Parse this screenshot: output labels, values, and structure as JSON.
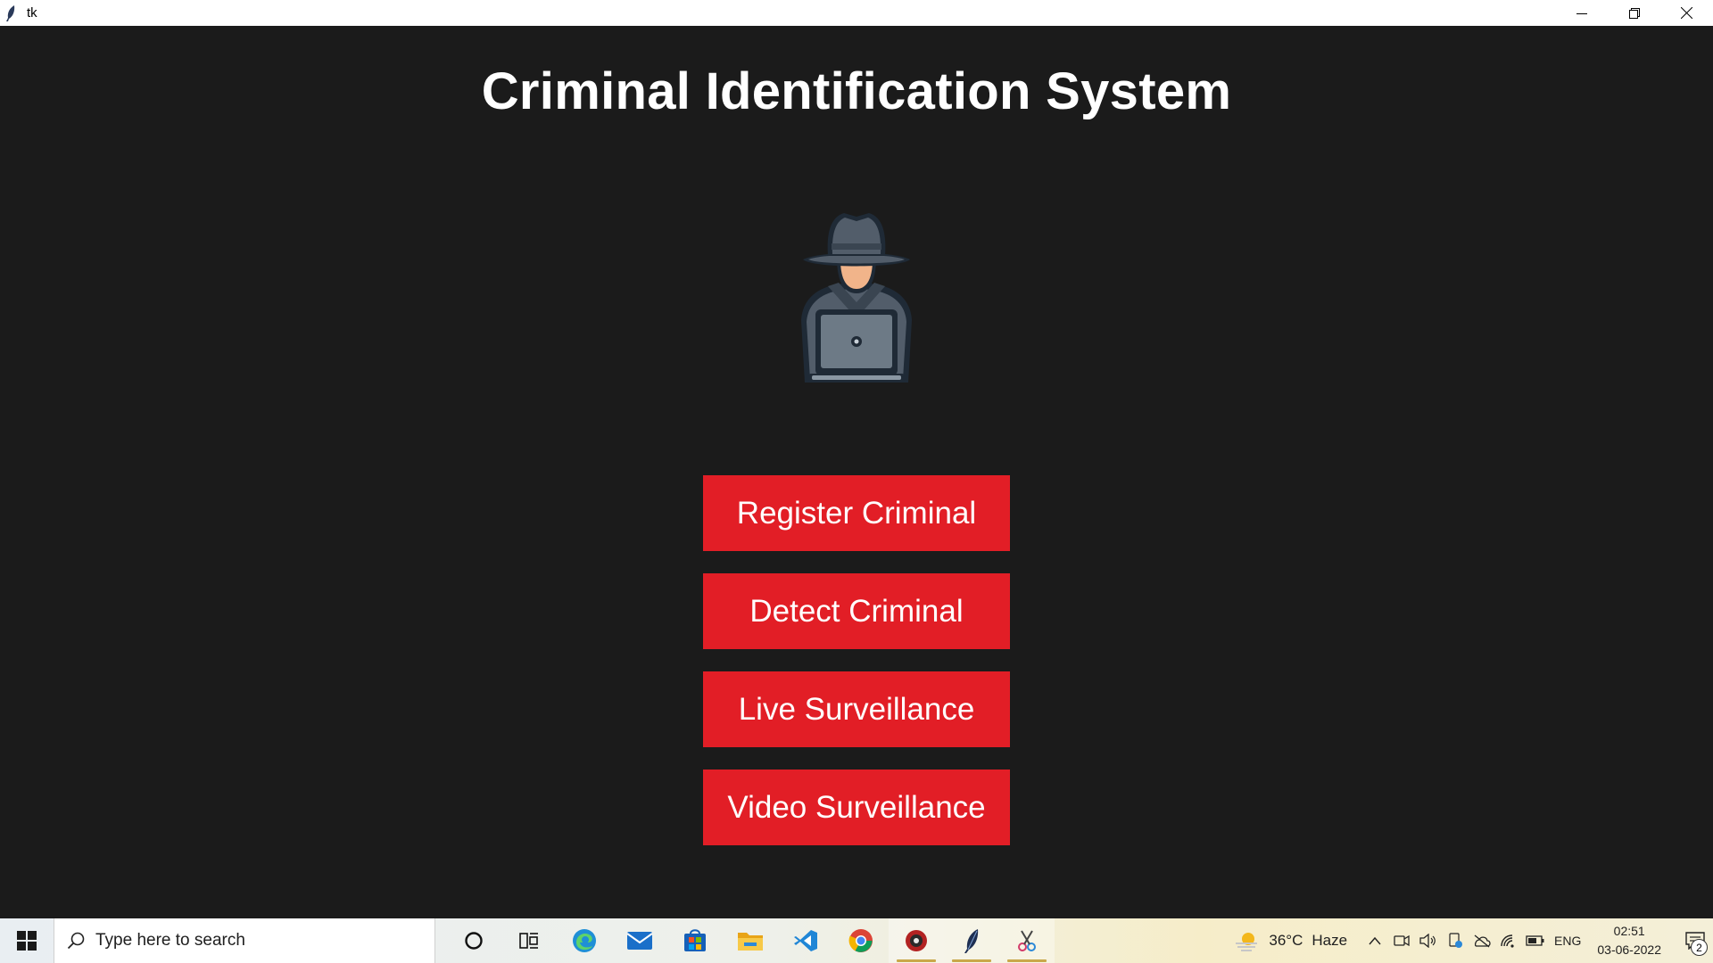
{
  "window": {
    "title": "tk",
    "controls": [
      "minimize",
      "restore",
      "close"
    ]
  },
  "app": {
    "heading": "Criminal Identification System",
    "hero_icon": "spy-with-laptop-icon",
    "buttons": [
      {
        "label": "Register Criminal"
      },
      {
        "label": "Detect Criminal"
      },
      {
        "label": "Live Surveillance"
      },
      {
        "label": "Video Surveillance"
      }
    ],
    "colors": {
      "background": "#1b1b1b",
      "button": "#e21e26",
      "text": "#ffffff"
    }
  },
  "taskbar": {
    "search_placeholder": "Type here to search",
    "pinned": [
      "cortana-icon",
      "task-view-icon",
      "edge-icon",
      "mail-icon",
      "store-icon",
      "file-explorer-icon",
      "vscode-icon",
      "chrome-icon",
      "app-icon",
      "python-feather-icon",
      "snip-icon"
    ],
    "weather": {
      "temp": "36°C",
      "condition": "Haze"
    },
    "language": "ENG",
    "time": "02:51",
    "date": "03-06-2022",
    "notification_count": "2"
  }
}
